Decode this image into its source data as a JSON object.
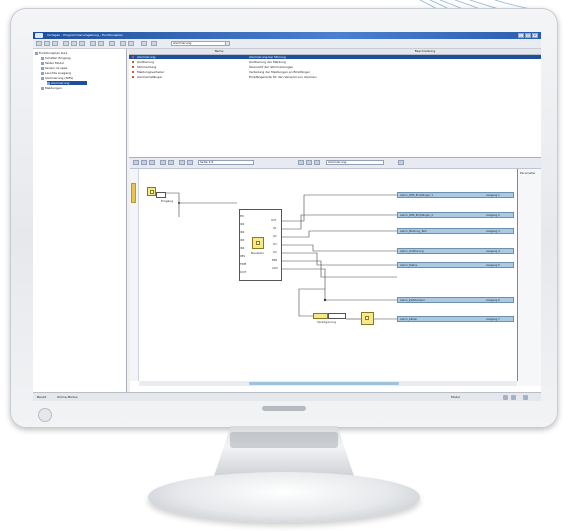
{
  "window": {
    "title": "Vorlagen - Programmierumgebung - Funktionsplan",
    "buttons": {
      "minimize": "_",
      "maximize": "□",
      "close": "×"
    }
  },
  "toolbar": {
    "field_value": "Alarmierung",
    "icons": [
      "new-icon",
      "open-icon",
      "save-icon",
      "cut-icon",
      "copy-icon",
      "paste-icon",
      "undo-icon",
      "redo-icon",
      "print-icon",
      "zoom-in-icon",
      "zoom-out-icon",
      "settings-icon",
      "help-icon"
    ]
  },
  "tree": {
    "items": [
      {
        "label": "Funktionsplan Kurs",
        "level": 0,
        "selected": false
      },
      {
        "label": "Schalter Eingang",
        "level": 1,
        "selected": false
      },
      {
        "label": "Taster Modul",
        "level": 1,
        "selected": false
      },
      {
        "label": "Sensor Gruppe",
        "level": 1,
        "selected": false
      },
      {
        "label": "Leuchte Ausgang",
        "level": 1,
        "selected": false
      },
      {
        "label": "Alarmierung (SMS)",
        "level": 1,
        "selected": false
      },
      {
        "label": "Alarmierung",
        "level": 2,
        "selected": true
      },
      {
        "label": "Meldungen",
        "level": 1,
        "selected": false
      }
    ]
  },
  "table": {
    "columns": [
      "Name",
      "Beschreibung"
    ],
    "rows": [
      {
        "name": "Alarmierung",
        "description": "Alarmierung bei Störung",
        "selected": true
      },
      {
        "name": "Quittierung",
        "description": "Quittierung der Meldung",
        "selected": false
      },
      {
        "name": "Störmeldung",
        "description": "Übersicht der Störmeldungen",
        "selected": false
      },
      {
        "name": "Meldungsverteiler",
        "description": "Verteilung der Meldungen an Empfänger",
        "selected": false
      },
      {
        "name": "Alarmempfänger",
        "description": "Empfängerliste für den Versand von Alarmen",
        "selected": false
      }
    ]
  },
  "editor": {
    "field1": "Seite 1/2",
    "field2": "Alarmierung",
    "right_panel_label": "Parameter"
  },
  "diagram": {
    "input_block_label": "Eingang",
    "main_block_label": "Baustein",
    "timer_label": "Verzögerung",
    "pins_left": [
      "EN",
      "IN1",
      "IN2",
      "IN3",
      "IN4",
      "RES",
      "TIME",
      "QUIT"
    ],
    "pins_right": [
      "OUT",
      "Q1",
      "Q2",
      "Q3",
      "Q4",
      "ERR",
      "ALM"
    ],
    "outputs": [
      {
        "text": "Alarm_SMS_Empfänger_1",
        "value": "Ausgang 1"
      },
      {
        "text": "Alarm_SMS_Empfänger_2",
        "value": "Ausgang 2"
      },
      {
        "text": "Alarm_Meldung_Text",
        "value": "Ausgang 3"
      },
      {
        "text": "Alarm_Quittierung",
        "value": "Ausgang 4"
      },
      {
        "text": "Alarm_Status",
        "value": "Ausgang 5"
      },
      {
        "text": "Alarm_Zeitstempel",
        "value": "Ausgang 6"
      },
      {
        "text": "Alarm_Zähler",
        "value": "Ausgang 7"
      }
    ]
  },
  "status": {
    "left": "Bereit",
    "mode": "Online-Modus",
    "right_value": "Modul"
  }
}
